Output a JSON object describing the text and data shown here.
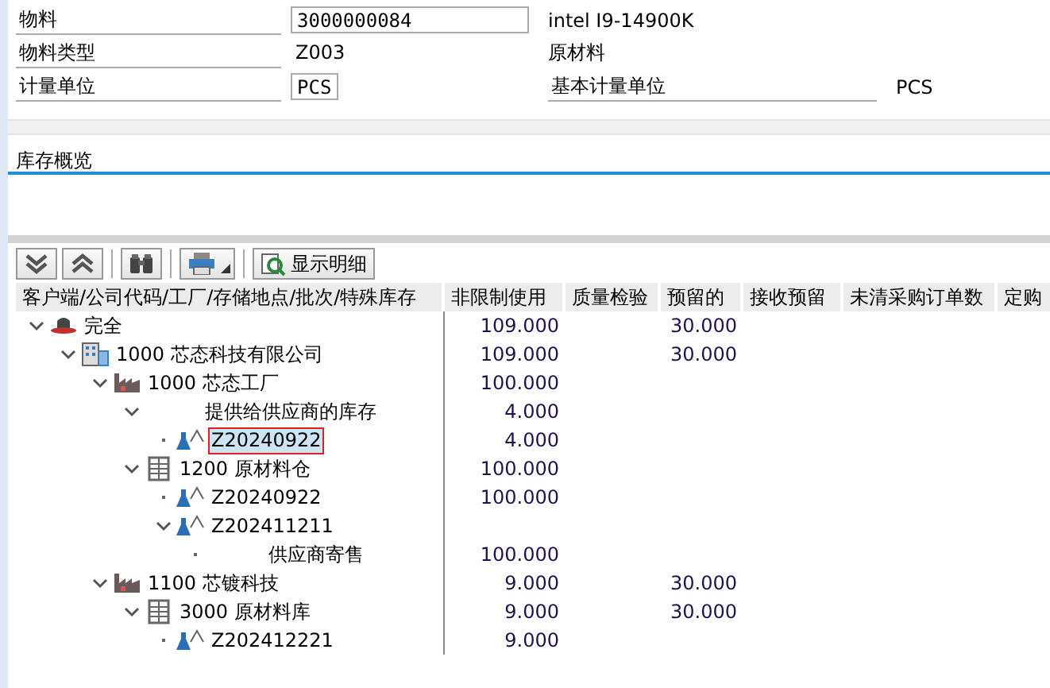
{
  "header": {
    "fields": [
      {
        "label": "物料",
        "value": "3000000084",
        "boxed": true,
        "description": "intel I9-14900K"
      },
      {
        "label": "物料类型",
        "value": "Z003",
        "boxed": false,
        "description": "原材料"
      },
      {
        "label": "计量单位",
        "value": "PCS",
        "boxed": true,
        "extra_label": "基本计量单位",
        "extra_value": "PCS"
      }
    ]
  },
  "section": {
    "title": "库存概览"
  },
  "toolbar": {
    "buttons": [
      {
        "kind": "expand"
      },
      {
        "kind": "collapse"
      },
      {
        "kind": "find"
      },
      {
        "kind": "print"
      },
      {
        "kind": "detail",
        "label": "显示明细"
      }
    ]
  },
  "table": {
    "columns": [
      "客户端/公司代码/工厂/存储地点/批次/特殊库存",
      "非限制使用",
      "质量检验",
      "预留的",
      "接收预留",
      "未清采购订单数",
      "定购"
    ],
    "rows": [
      {
        "kind": "client",
        "label": "完全",
        "expanded": true,
        "selected": false,
        "unrestricted": "109.000",
        "reserved": "30.000",
        "children": [
          {
            "kind": "company",
            "label": "1000 芯态科技有限公司",
            "expanded": true,
            "selected": false,
            "unrestricted": "109.000",
            "reserved": "30.000",
            "children": [
              {
                "kind": "plant",
                "label": "1000 芯态工厂",
                "expanded": true,
                "selected": false,
                "unrestricted": "100.000",
                "children": [
                  {
                    "kind": "special",
                    "label": "提供给供应商的库存",
                    "expanded": true,
                    "selected": false,
                    "unrestricted": "4.000",
                    "children": [
                      {
                        "kind": "batch",
                        "label": "Z20240922",
                        "expanded": false,
                        "selected": true,
                        "unrestricted": "4.000"
                      }
                    ]
                  },
                  {
                    "kind": "storage",
                    "label": "1200 原材料仓",
                    "expanded": true,
                    "selected": false,
                    "unrestricted": "100.000",
                    "children": [
                      {
                        "kind": "batch",
                        "label": "Z20240922",
                        "expanded": false,
                        "selected": false,
                        "unrestricted": "100.000"
                      },
                      {
                        "kind": "batch",
                        "label": "Z202411211",
                        "expanded": true,
                        "selected": false,
                        "children": [
                          {
                            "kind": "special",
                            "label": "供应商寄售",
                            "expanded": false,
                            "selected": false,
                            "unrestricted": "100.000"
                          }
                        ]
                      }
                    ]
                  }
                ]
              },
              {
                "kind": "plant",
                "label": "1100 芯镀科技",
                "expanded": true,
                "selected": false,
                "unrestricted": "9.000",
                "reserved": "30.000",
                "children": [
                  {
                    "kind": "storage",
                    "label": "3000 原材料库",
                    "expanded": true,
                    "selected": false,
                    "unrestricted": "9.000",
                    "reserved": "30.000",
                    "children": [
                      {
                        "kind": "batch",
                        "label": "Z202412221",
                        "expanded": false,
                        "selected": false,
                        "unrestricted": "9.000"
                      }
                    ]
                  }
                ]
              }
            ]
          }
        ]
      }
    ]
  }
}
